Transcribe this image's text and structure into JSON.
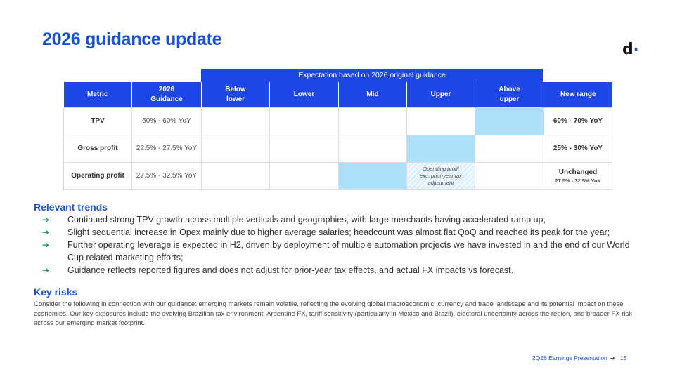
{
  "slide": {
    "title": "2026 guidance update",
    "logo": {
      "letter": "d",
      "dot": "·"
    }
  },
  "table": {
    "band_label": "Expectation based on 2026 original guidance",
    "headers": {
      "metric": "Metric",
      "guidance_l1": "2026",
      "guidance_l2": "Guidance",
      "below_l1": "Below",
      "below_l2": "lower",
      "lower": "Lower",
      "mid": "Mid",
      "upper": "Upper",
      "above_l1": "Above",
      "above_l2": "upper",
      "new_range": "New range"
    },
    "rows": [
      {
        "metric": "TPV",
        "guidance": "50% - 60% YoY",
        "new_range": "60% - 70% YoY",
        "highlight": "above_upper"
      },
      {
        "metric": "Gross profit",
        "guidance": "22.5% - 27.5% YoY",
        "new_range": "25% - 30% YoY",
        "highlight": "upper"
      },
      {
        "metric": "Operating profit",
        "guidance": "27.5% - 32.5% YoY",
        "new_range": "Unchanged",
        "new_range_sub": "27.5% - 32.5% YoY",
        "highlight": "mid",
        "upper_note_l1": "Operating profit",
        "upper_note_l2": "exc. prior-year tax",
        "upper_note_l3": "adjustment"
      }
    ],
    "colors": {
      "header": "#1f46e6",
      "highlight": "#aee0fb"
    }
  },
  "trends": {
    "heading": "Relevant trends",
    "items": [
      "Continued strong TPV growth across multiple verticals and geographies, with large merchants having accelerated ramp up;",
      "Slight sequential increase in Opex mainly due to higher average salaries; headcount was almost flat QoQ and reached its peak for the year;",
      "Further operating leverage is expected in H2, driven by deployment of multiple automation projects we have invested in and the end of our World Cup related marketing efforts;",
      "Guidance reflects reported figures and does not adjust for prior-year tax effects, and actual FX impacts vs forecast."
    ],
    "bullet": "➔"
  },
  "risks": {
    "heading": "Key risks",
    "text": "Consider the following in connection with our guidance: emerging markets remain volatile, reflecting the evolving global macroeconomic, currency and trade landscape and its potential impact on these economies. Our key exposures include the evolving Brazilian tax environment, Argentine FX, tariff sensitivity (particularly in Mexico and Brazil), electoral uncertainty across the region, and broader FX risk across our emerging market footprint."
  },
  "footer": {
    "label": "2Q26 Earnings Presentation",
    "arrow": "➔",
    "page": "16"
  }
}
